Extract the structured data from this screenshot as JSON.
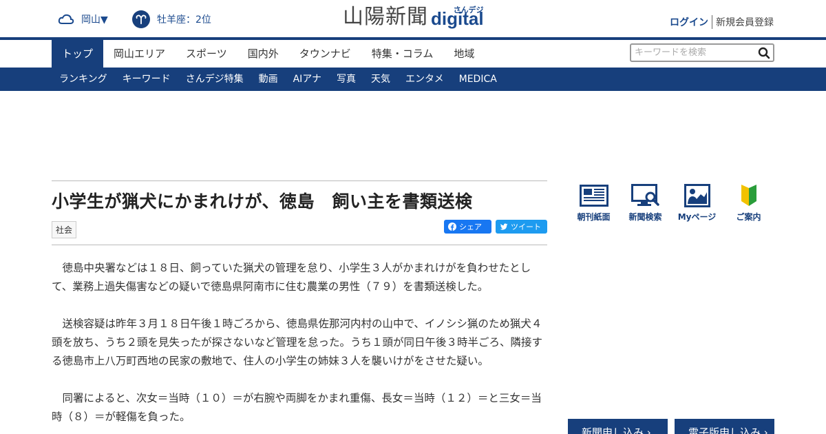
{
  "header": {
    "weather_location": "岡山▼",
    "horoscope": "牡羊座：2位",
    "logo_kanji": "山陽新聞",
    "logo_digital": "digital",
    "logo_sande": "さんデジ",
    "login": "ログイン",
    "register": "新規会員登録"
  },
  "main_nav": [
    "トップ",
    "岡山エリア",
    "スポーツ",
    "国内外",
    "タウンナビ",
    "特集・コラム",
    "地域"
  ],
  "search": {
    "placeholder": "キーワードを検索"
  },
  "sub_nav": [
    "ランキング",
    "キーワード",
    "さんデジ特集",
    "動画",
    "AIアナ",
    "写真",
    "天気",
    "エンタメ",
    "MEDICA"
  ],
  "article": {
    "title": "小学生が猟犬にかまれけが、徳島　飼い主を書類送検",
    "category": "社会",
    "share_facebook": "シェア",
    "share_twitter": "ツイート",
    "paragraphs": [
      "徳島中央署などは１８日、飼っていた猟犬の管理を怠り、小学生３人がかまれけがを負わせたとして、業務上過失傷害などの疑いで徳島県阿南市に住む農業の男性（７９）を書類送検した。",
      "送検容疑は昨年３月１８日午後１時ごろから、徳島県佐那河内村の山中で、イノシシ猟のため猟犬４頭を放ち、うち２頭を見失ったが探さないなど管理を怠った。うち１頭が同日午後３時半ごろ、隣接する徳島市上八万町西地の民家の敷地で、住人の小学生の姉妹３人を襲いけがをさせた疑い。",
      "同署によると、次女＝当時（１０）＝が右腕や両脚をかまれ重傷、長女＝当時（１２）＝と三女＝当時（８）＝が軽傷を負った。"
    ]
  },
  "sidebar": {
    "icons": [
      {
        "label": "朝刊紙面",
        "icon": "newspaper-icon"
      },
      {
        "label": "新聞検索",
        "icon": "monitor-search-icon"
      },
      {
        "label": "Myページ",
        "icon": "person-chart-icon"
      },
      {
        "label": "ご案内",
        "icon": "beginner-mark-icon"
      }
    ],
    "buttons": [
      "新聞申し込み ›",
      "電子版申し込み ›"
    ]
  },
  "colors": {
    "brand_navy": "#173f7c",
    "facebook": "#1877f2",
    "twitter": "#1d9bf0"
  }
}
